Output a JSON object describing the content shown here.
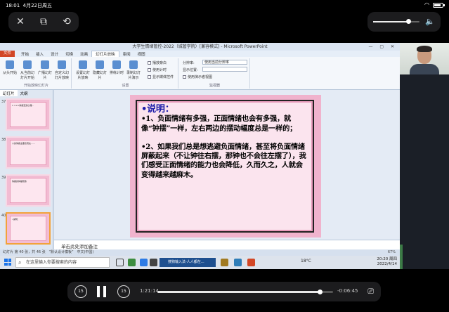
{
  "status_bar": {
    "time": "18:01",
    "date": "4月22日周五"
  },
  "video_controls": {
    "volume_fraction": 0.75
  },
  "powerpoint": {
    "window_title": "大学生情绪管控-2022（城管学院）[兼容模式] - Microsoft PowerPoint",
    "menu": [
      "文件",
      "开始",
      "插入",
      "设计",
      "切换",
      "动画",
      "幻灯片放映",
      "审阅",
      "视图"
    ],
    "active_menu": "幻灯片放映",
    "ribbon": {
      "start_group": {
        "label": "开始放映幻灯片",
        "buttons": [
          "从头开始",
          "从当前幻灯片开始",
          "广播幻灯片",
          "自定义幻灯片放映"
        ]
      },
      "setup_group": {
        "label": "设置",
        "buttons": [
          "设置幻灯片放映",
          "隐藏幻灯片",
          "排练计时",
          "录制幻灯片演示"
        ],
        "checks": [
          "播放旁白",
          "使用计时",
          "显示媒体控件"
        ]
      },
      "monitor_group": {
        "label": "监视器",
        "resolution": "分辨率:",
        "resolution_value": "使用当前分辨率",
        "show_on": "显示位置:",
        "presenter_view": "使用演示者视图"
      }
    },
    "left_tabs": [
      "幻灯片",
      "大纲"
    ],
    "thumbnails": [
      {
        "num": "37",
        "text": "1 ×××情绪宣泄心理..."
      },
      {
        "num": "38",
        "text": "人的情绪主要表现在……"
      },
      {
        "num": "39",
        "text": "情绪的钟摆现象"
      },
      {
        "num": "40",
        "text": "•说明："
      }
    ],
    "slide": {
      "heading": "•说明：",
      "paragraphs": [
        "•1、负面情绪有多强，正面情绪也会有多强，就像“钟摆”一样，左右两边的摆动幅度总是一样的；",
        "•2、如果我们总是想逃避负面情绪，甚至将负面情绪屏蔽起来（不让钟往右摆，那钟也不会往左摆了），我们感受正面情绪的能力也会降低，久而久之，人就会变得越来越麻木。"
      ]
    },
    "notes_placeholder": "单击此处添加备注",
    "status": {
      "slide_info": "幻灯片 第 40 张，共 46 张",
      "theme": "“默认设计模板”",
      "lang": "中文(中国)",
      "zoom": "67%"
    }
  },
  "taskbar": {
    "search_placeholder": "在这里输入你要搜索的内容",
    "edge_label": "搜狗输入法-人人都在…",
    "temperature": "18°C",
    "clock_time": "20:20 周四",
    "clock_date": "2022/4/14"
  },
  "playback": {
    "skip_back": "15",
    "skip_forward": "15",
    "current_time": "1:21:14",
    "remaining_time": "-0:06:45",
    "progress_fraction": 0.923
  }
}
